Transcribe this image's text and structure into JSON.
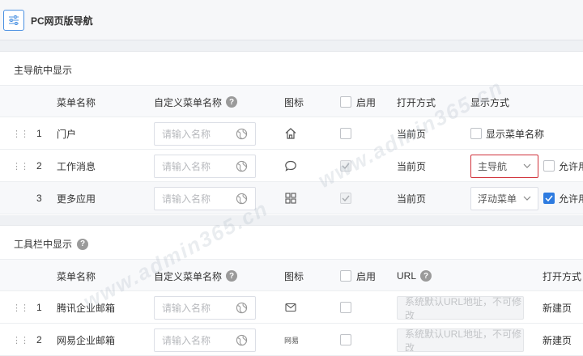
{
  "header": {
    "title": "PC网页版导航",
    "menu_icon": "sliders-icon"
  },
  "main_nav": {
    "title": "主导航中显示",
    "columns": {
      "name": "菜单名称",
      "custom_name": "自定义菜单名称",
      "icon": "图标",
      "enable": "启用",
      "open_mode": "打开方式",
      "display_mode": "显示方式"
    },
    "rows": [
      {
        "index": "1",
        "name": "门户",
        "placeholder": "请输入名称",
        "icon": "home-icon",
        "open_mode": "当前页",
        "display_option": "显示菜单名称"
      },
      {
        "index": "2",
        "name": "工作消息",
        "placeholder": "请输入名称",
        "icon": "chat-bubble-icon",
        "open_mode": "当前页",
        "display_select": "主导航",
        "allow_label": "允许用"
      },
      {
        "index": "3",
        "name": "更多应用",
        "placeholder": "请输入名称",
        "icon": "grid-icon",
        "open_mode": "当前页",
        "display_select": "浮动菜单",
        "allow_label": "允许用"
      }
    ]
  },
  "toolbar_nav": {
    "title": "工具栏中显示",
    "columns": {
      "name": "菜单名称",
      "custom_name": "自定义菜单名称",
      "icon": "图标",
      "enable": "启用",
      "url": "URL",
      "open_mode": "打开方式"
    },
    "rows": [
      {
        "index": "1",
        "name": "腾讯企业邮箱",
        "placeholder": "请输入名称",
        "icon": "mail-icon",
        "url_placeholder": "系统默认URL地址，不可修改",
        "open_mode": "新建页"
      },
      {
        "index": "2",
        "name": "网易企业邮箱",
        "placeholder": "请输入名称",
        "icon": "netease-logo-icon",
        "icon_text": "网易",
        "url_placeholder": "系统默认URL地址，不可修改",
        "open_mode": "新建页"
      }
    ]
  },
  "colors": {
    "accent": "#2d7be0",
    "error": "#d0323b"
  }
}
